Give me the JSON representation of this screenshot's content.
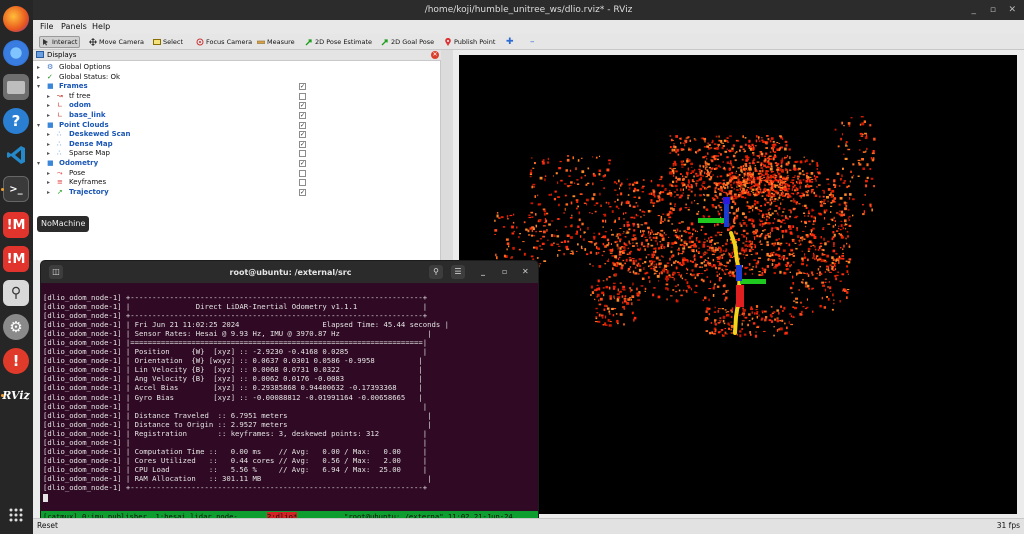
{
  "window": {
    "title": "/home/koji/humble_unitree_ws/dlio.rviz* - RViz"
  },
  "menu": [
    "File",
    "Panels",
    "Help"
  ],
  "toolbar": [
    "Interact",
    "Move Camera",
    "Select",
    "Focus Camera",
    "Measure",
    "2D Pose Estimate",
    "2D Goal Pose",
    "Publish Point"
  ],
  "displays": {
    "title": "Displays",
    "items": [
      {
        "label": "Global Options",
        "icon": "gear-icon"
      },
      {
        "label": "Global Status: Ok",
        "icon": "check-icon"
      },
      {
        "label": "Frames",
        "icon": "folder-icon"
      },
      {
        "label": "tf tree",
        "icon": "tf-icon"
      },
      {
        "label": "odom",
        "icon": "axes-icon"
      },
      {
        "label": "base_link",
        "icon": "axes-icon"
      },
      {
        "label": "Point Clouds",
        "icon": "folder-icon"
      },
      {
        "label": "Deskewed Scan",
        "icon": "pointcloud-icon"
      },
      {
        "label": "Dense Map",
        "icon": "pointcloud-icon"
      },
      {
        "label": "Sparse Map",
        "icon": "pointcloud-icon"
      },
      {
        "label": "Odometry",
        "icon": "folder-icon"
      },
      {
        "label": "Pose",
        "icon": "pose-icon"
      },
      {
        "label": "Keyframes",
        "icon": "keyframes-icon"
      },
      {
        "label": "Trajectory",
        "icon": "trajectory-icon"
      }
    ]
  },
  "tooltip": "NoMachine",
  "status": {
    "reset": "Reset",
    "fps": "31 fps"
  },
  "terminal": {
    "title": "root@ubuntu: /external/src",
    "lines": [
      "[dlio_odom_node-1] +-------------------------------------------------------------------+",
      "[dlio_odom_node-1] |               Direct LiDAR-Inertial Odometry v1.1.1               |",
      "[dlio_odom_node-1] +-------------------------------------------------------------------+",
      "[dlio_odom_node-1] | Fri Jun 21 11:02:25 2024                   Elapsed Time: 45.44 seconds |",
      "[dlio_odom_node-1] | Sensor Rates: Hesai @ 9.93 Hz, IMU @ 3970.87 Hz                    |",
      "[dlio_odom_node-1] |===================================================================|",
      "[dlio_odom_node-1] | Position     {W}  [xyz] :: -2.9230 -0.4168 0.0285                 |",
      "[dlio_odom_node-1] | Orientation  {W} [wxyz] :: 0.0637 0.0301 0.0586 -0.9958          |",
      "[dlio_odom_node-1] | Lin Velocity {B}  [xyz] :: 0.0068 0.0731 0.0322                  |",
      "[dlio_odom_node-1] | Ang Velocity {B}  [xyz] :: 0.0062 0.0176 -0.0083                 |",
      "[dlio_odom_node-1] | Accel Bias        [xyz] :: 0.29385868 0.94400632 -0.17393368     |",
      "[dlio_odom_node-1] | Gyro Bias         [xyz] :: -0.00088812 -0.01991164 -0.00658665   |",
      "[dlio_odom_node-1] |                                                                   |",
      "[dlio_odom_node-1] | Distance Traveled  :: 6.7951 meters                                |",
      "[dlio_odom_node-1] | Distance to Origin :: 2.9527 meters                                |",
      "[dlio_odom_node-1] | Registration       :: keyframes: 3, deskewed points: 312          |",
      "[dlio_odom_node-1] |                                                                   |",
      "[dlio_odom_node-1] | Computation Time ::   0.00 ms    // Avg:   0.00 / Max:   0.00     |",
      "[dlio_odom_node-1] | Cores Utilized   ::   0.44 cores // Avg:   0.56 / Max:   2.00     |",
      "[dlio_odom_node-1] | CPU Load         ::   5.56 %     // Avg:   6.94 / Max:  25.00     |",
      "[dlio_odom_node-1] | RAM Allocation   :: 301.11 MB                                      |",
      "[dlio_odom_node-1] +-------------------------------------------------------------------+"
    ],
    "tmux_left": "[catmux] 0:imu_publisher  1:hesai_lidar_node- ",
    "tmux_mid": "2:dlio*",
    "tmux_right": "\"root@ubuntu: /externa\" 11:02 21-Jun-24"
  },
  "colors": {
    "terminal_bg": "#300a24",
    "tmux_green": "#0e9e2f",
    "trajectory": "#f2d21b",
    "axis_green": "#1ec81e",
    "cloud": "#ff3c14"
  }
}
